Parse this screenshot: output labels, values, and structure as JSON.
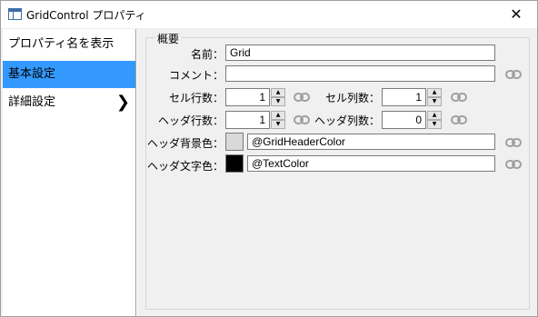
{
  "window": {
    "title": "GridControl プロパティ",
    "close_glyph": "✕"
  },
  "sidebar": {
    "items": [
      {
        "label": "プロパティ名を表示"
      },
      {
        "label": "基本設定"
      },
      {
        "label": "詳細設定",
        "chevron": "❯"
      }
    ],
    "active_index": 1,
    "accent_color": "#3399ff"
  },
  "group": {
    "title": "概要"
  },
  "fields": {
    "name": {
      "label": "名前：",
      "value": "Grid"
    },
    "comment": {
      "label": "コメント：",
      "value": ""
    },
    "cell_rows": {
      "label": "セル行数：",
      "value": "1"
    },
    "cell_cols": {
      "label": "セル列数：",
      "value": "1"
    },
    "header_rows": {
      "label": "ヘッダ行数：",
      "value": "1"
    },
    "header_cols": {
      "label": "ヘッダ列数：",
      "value": "0"
    },
    "header_bg": {
      "label": "ヘッダ背景色：",
      "value": "@GridHeaderColor",
      "swatch": "#d9d9d9"
    },
    "text_color": {
      "label": "ヘッダ文字色：",
      "value": "@TextColor",
      "swatch": "#000000"
    }
  },
  "spinner": {
    "up": "▲",
    "down": "▼"
  },
  "icons": {
    "link": "link-icon"
  }
}
